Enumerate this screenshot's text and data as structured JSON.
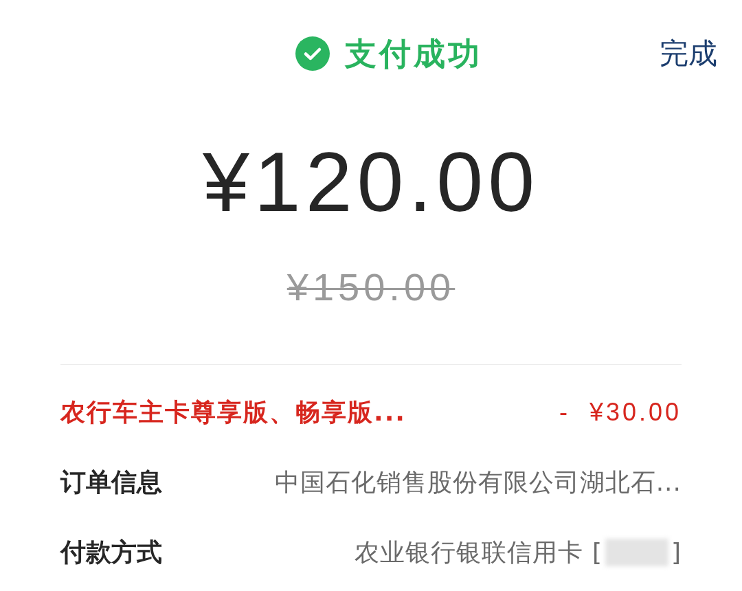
{
  "header": {
    "title": "支付成功",
    "done_button": "完成"
  },
  "amount": {
    "paid": "¥120.00",
    "original": "¥150.00"
  },
  "details": [
    {
      "kind": "discount",
      "label": "农行车主卡尊享版、畅享版...",
      "value": "- ¥30.00"
    },
    {
      "kind": "info",
      "label": "订单信息",
      "value": "中国石化销售股份有限公司湖北石..."
    },
    {
      "kind": "info",
      "label": "付款方式",
      "value": "农业银行银联信用卡 [",
      "masked": true,
      "value_end": "]"
    }
  ]
}
